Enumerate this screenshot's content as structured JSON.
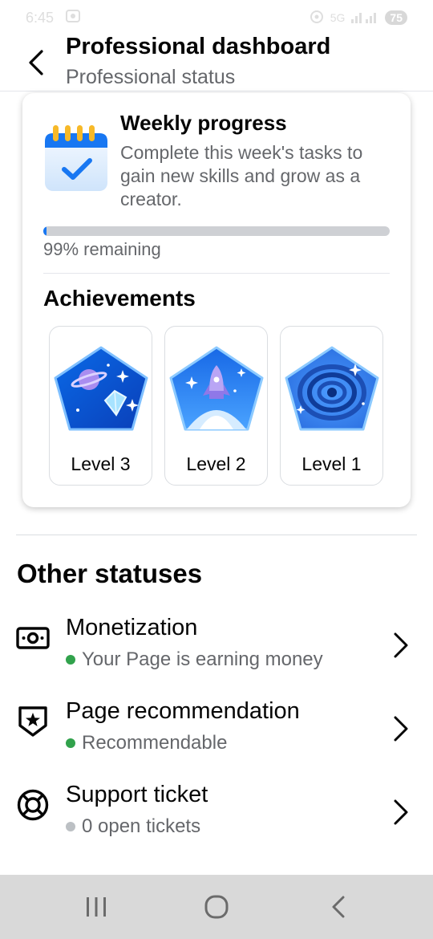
{
  "status_bar": {
    "time": "6:45",
    "network": "5G",
    "battery": "75"
  },
  "header": {
    "title": "Professional dashboard",
    "subtitle": "Professional status"
  },
  "weekly": {
    "title": "Weekly progress",
    "description": "Complete this week's tasks to gain new skills and grow as a creator.",
    "progress_fraction": 0.01,
    "remaining_text": "99% remaining"
  },
  "achievements": {
    "title": "Achievements",
    "badges": [
      {
        "label": "Level 3",
        "icon": "planet-diamond-icon"
      },
      {
        "label": "Level 2",
        "icon": "rocket-icon"
      },
      {
        "label": "Level 1",
        "icon": "galaxy-icon"
      }
    ]
  },
  "other": {
    "title": "Other statuses",
    "rows": [
      {
        "name": "Monetization",
        "sub": "Your Page is earning money",
        "dot_color": "#31a24c",
        "icon": "money-icon"
      },
      {
        "name": "Page recommendation",
        "sub": "Recommendable",
        "dot_color": "#31a24c",
        "icon": "shield-star-icon"
      },
      {
        "name": "Support ticket",
        "sub": "0 open tickets",
        "dot_color": "#bcc0c4",
        "icon": "lifebuoy-icon"
      }
    ]
  },
  "colors": {
    "accent": "#1877f2",
    "success": "#31a24c",
    "muted": "#65676b"
  }
}
